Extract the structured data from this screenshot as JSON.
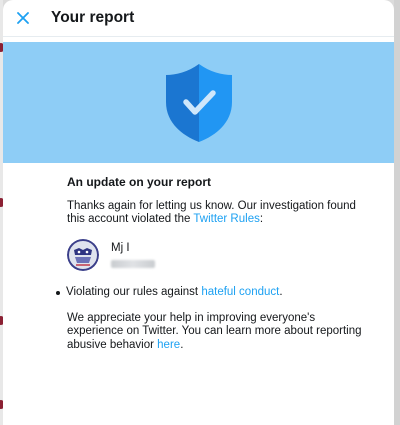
{
  "dialog": {
    "title": "Your report",
    "close_icon": "close-icon"
  },
  "banner": {
    "icon": "shield-check-icon",
    "colors": {
      "background": "#8ecdf6",
      "shield_left": "#1b76d1",
      "shield_right": "#2196f3",
      "check": "#cfe7fb"
    }
  },
  "update": {
    "title": "An update on your report",
    "intro_text": "Thanks again for letting us know. Our investigation found this account violated the ",
    "rules_link": "Twitter Rules",
    "intro_end": ":"
  },
  "account": {
    "name": "Mj I",
    "avatar_icon": "avatar"
  },
  "violation": {
    "text": "Violating our rules against ",
    "link": "hateful conduct",
    "end": "."
  },
  "closing": {
    "text": "We appreciate your help in improving everyone's experience on Twitter. You can learn more about reporting abusive behavior ",
    "link": "here",
    "end": "."
  },
  "colors": {
    "accent": "#1da1f2",
    "text": "#14171a"
  }
}
